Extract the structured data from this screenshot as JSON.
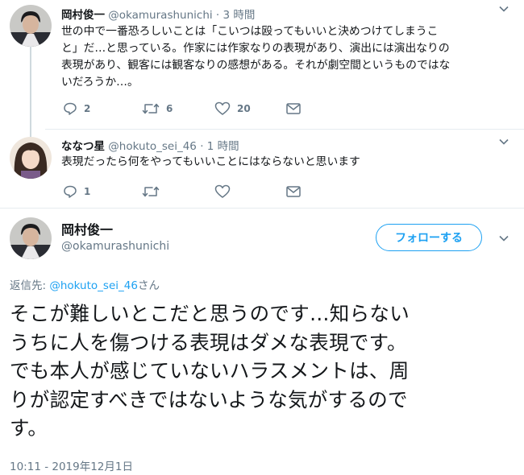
{
  "tweet1": {
    "name": "岡村俊一",
    "handle": "@okamurashunichi",
    "time": "· 3 時間",
    "lines": [
      "世の中で一番恐ろしいことは「こいつは殴ってもいいと決めつけてしまうこ",
      "と」だ…と思っている。作家には作家なりの表現があり、演出には演出なりの",
      "表現があり、観客には観客なりの感想がある。それが劇空間というものではな",
      "いだろうか…。"
    ],
    "reply_count": "2",
    "retweet_count": "6",
    "like_count": "20"
  },
  "tweet2": {
    "name": "ななつ星",
    "handle": "@hokuto_sei_46",
    "time": "· 1 時間",
    "text": "表現だったら何をやってもいいことにはならないと思います",
    "reply_count": "1"
  },
  "main": {
    "name": "岡村俊一",
    "handle": "@okamurashunichi",
    "follow_label": "フォローする",
    "reply_prefix": "返信先: ",
    "reply_mention": "@hokuto_sei_46",
    "reply_suffix": "さん",
    "lines": [
      "そこが難しいとこだと思うのです…知らない",
      "うちに人を傷つける表現はダメな表現です。",
      "でも本人が感じていないハラスメントは、周",
      "りが認定すべきではないような気がするので",
      "す。"
    ],
    "timestamp": "10:11 - 2019年12月1日"
  },
  "colors": {
    "accent": "#1da1f2",
    "muted": "#657786",
    "text": "#14171a",
    "divider": "#e6ecf0"
  },
  "icons": [
    "reply-icon",
    "retweet-icon",
    "like-icon",
    "dm-icon",
    "chevron-down-icon"
  ]
}
